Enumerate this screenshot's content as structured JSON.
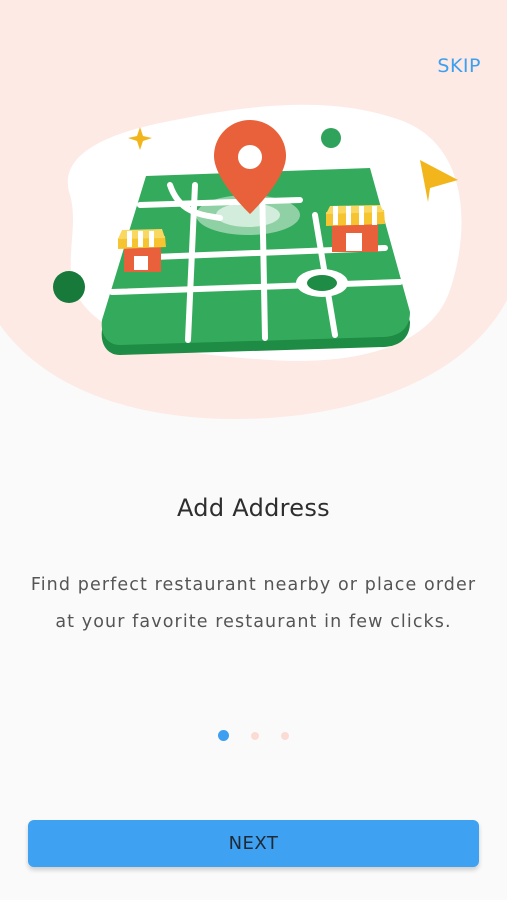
{
  "header": {
    "skip_label": "SKIP"
  },
  "onboarding": {
    "title": "Add Address",
    "description": "Find perfect restaurant nearby or place order at your favorite restaurant in few clicks.",
    "pagination": {
      "total": 3,
      "active_index": 0
    }
  },
  "footer": {
    "next_label": "NEXT"
  },
  "colors": {
    "accent": "#3d9ff0",
    "hero_background": "#fdeae4",
    "map_green": "#33a85b",
    "pin_orange": "#e8613a"
  },
  "illustration": {
    "icons": [
      "map-icon",
      "location-pin-icon",
      "restaurant-icon",
      "sparkle-icon",
      "navigation-arrow-icon"
    ]
  }
}
